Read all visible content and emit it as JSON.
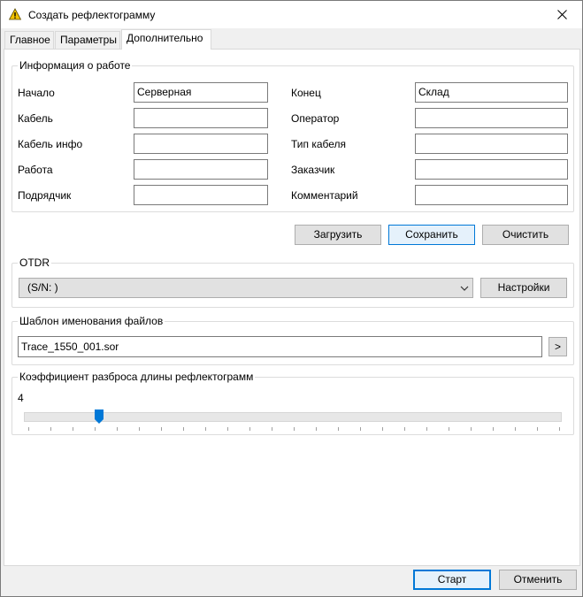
{
  "window": {
    "title": "Создать рефлектограмму"
  },
  "tabs": [
    {
      "label": "Главное"
    },
    {
      "label": "Параметры"
    },
    {
      "label": "Дополнительно"
    }
  ],
  "job_info": {
    "group_title": "Информация о работе",
    "fields_left": [
      {
        "label": "Начало",
        "value": "Серверная"
      },
      {
        "label": "Кабель",
        "value": ""
      },
      {
        "label": "Кабель инфо",
        "value": ""
      },
      {
        "label": "Работа",
        "value": ""
      },
      {
        "label": "Подрядчик",
        "value": ""
      }
    ],
    "fields_right": [
      {
        "label": "Конец",
        "value": "Склад"
      },
      {
        "label": "Оператор",
        "value": ""
      },
      {
        "label": "Тип кабеля",
        "value": ""
      },
      {
        "label": "Заказчик",
        "value": ""
      },
      {
        "label": "Комментарий",
        "value": ""
      }
    ]
  },
  "actions": {
    "load_label": "Загрузить",
    "save_label": "Сохранить",
    "clear_label": "Очистить"
  },
  "otdr": {
    "group_title": "OTDR",
    "selected_device": "(S/N:  )",
    "settings_label": "Настройки"
  },
  "filename_template": {
    "group_title": "Шаблон именования файлов",
    "value": "Trace_1550_001.sor",
    "browse_label": ">"
  },
  "spread": {
    "group_title": "Коэффициент разброса длины рефлектограмм",
    "value_text": "4",
    "slider_value_fraction": 0.14
  },
  "footer": {
    "start_label": "Старт",
    "cancel_label": "Отменить"
  },
  "colors": {
    "accent": "#0078d7",
    "warning_icon": "#f2c200"
  }
}
